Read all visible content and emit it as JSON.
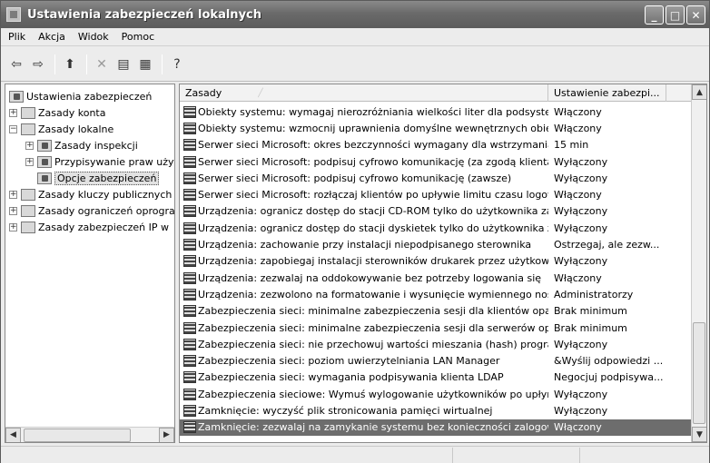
{
  "window": {
    "title": "Ustawienia zabezpieczeń lokalnych",
    "minimize": "_",
    "maximize": "□",
    "close": "✕"
  },
  "menu": [
    "Plik",
    "Akcja",
    "Widok",
    "Pomoc"
  ],
  "toolbar": {
    "icons": [
      "back-arrow-icon",
      "forward-arrow-icon",
      "up-folder-icon",
      "delete-icon",
      "properties-icon",
      "export-list-icon",
      "help-icon"
    ]
  },
  "tree": [
    {
      "label": "Ustawienia zabezpieczeń",
      "level": 0,
      "expander": "",
      "selected": false
    },
    {
      "label": "Zasady konta",
      "level": 1,
      "expander": "+",
      "selected": false
    },
    {
      "label": "Zasady lokalne",
      "level": 1,
      "expander": "−",
      "selected": false
    },
    {
      "label": "Zasady inspekcji",
      "level": 2,
      "expander": "+",
      "selected": false
    },
    {
      "label": "Przypisywanie praw użytkownika",
      "level": 2,
      "expander": "+",
      "selected": false
    },
    {
      "label": "Opcje zabezpieczeń",
      "level": 2,
      "expander": "",
      "selected": true
    },
    {
      "label": "Zasady kluczy publicznych",
      "level": 1,
      "expander": "+",
      "selected": false
    },
    {
      "label": "Zasady ograniczeń oprogramowania",
      "level": 1,
      "expander": "+",
      "selected": false
    },
    {
      "label": "Zasady zabezpieczeń IP w",
      "level": 1,
      "expander": "+",
      "selected": false
    }
  ],
  "list": {
    "headers": {
      "policy": "Zasady",
      "setting": "Ustawienie zabezpi..."
    },
    "rows": [
      {
        "policy": "Obiekty systemu: wymagaj nierozróżniania wielkości liter dla podsystemów...",
        "setting": "Włączony"
      },
      {
        "policy": "Obiekty systemu: wzmocnij uprawnienia domyślne wewnętrznych obiektó...",
        "setting": "Włączony"
      },
      {
        "policy": "Serwer sieci Microsoft: okres bezczynności wymagany dla wstrzymania sesji",
        "setting": "15 min"
      },
      {
        "policy": "Serwer sieci Microsoft: podpisuj cyfrowo komunikację (za zgodą klienta)",
        "setting": "Wyłączony"
      },
      {
        "policy": "Serwer sieci Microsoft: podpisuj cyfrowo komunikację (zawsze)",
        "setting": "Wyłączony"
      },
      {
        "policy": "Serwer sieci Microsoft: rozłączaj klientów po upływie limitu czasu logowania",
        "setting": "Włączony"
      },
      {
        "policy": "Urządzenia: ogranicz dostęp do stacji CD-ROM tylko do użytkownika zalog...",
        "setting": "Wyłączony"
      },
      {
        "policy": "Urządzenia: ogranicz dostęp do stacji dyskietek tylko do użytkownika zalo...",
        "setting": "Wyłączony"
      },
      {
        "policy": "Urządzenia: zachowanie przy instalacji niepodpisanego sterownika",
        "setting": "Ostrzegaj, ale zezw..."
      },
      {
        "policy": "Urządzenia: zapobiegaj instalacji sterowników drukarek przez użytkowników",
        "setting": "Wyłączony"
      },
      {
        "policy": "Urządzenia: zezwalaj na oddokowywanie bez potrzeby logowania się",
        "setting": "Włączony"
      },
      {
        "policy": "Urządzenia: zezwolono na formatowanie i wysunięcie wymiennego nośnika",
        "setting": "Administratorzy"
      },
      {
        "policy": "Zabezpieczenia sieci: minimalne zabezpieczenia sesji dla klientów opartych ...",
        "setting": "Brak minimum"
      },
      {
        "policy": "Zabezpieczenia sieci: minimalne zabezpieczenia sesji dla serwerów opartyc...",
        "setting": "Brak minimum"
      },
      {
        "policy": "Zabezpieczenia sieci: nie przechowuj wartości mieszania (hash) programu ...",
        "setting": "Wyłączony"
      },
      {
        "policy": "Zabezpieczenia sieci: poziom uwierzytelniania LAN Manager",
        "setting": "&Wyślij odpowiedzi ..."
      },
      {
        "policy": "Zabezpieczenia sieci: wymagania podpisywania klienta LDAP",
        "setting": "Negocjuj podpisywa..."
      },
      {
        "policy": "Zabezpieczenia sieciowe: Wymuś wylogowanie użytkowników po upłynięci...",
        "setting": "Wyłączony"
      },
      {
        "policy": "Zamknięcie: wyczyść plik stronicowania pamięci wirtualnej",
        "setting": "Wyłączony"
      },
      {
        "policy": "Zamknięcie: zezwalaj na zamykanie systemu bez konieczności zalogowania",
        "setting": "Włączony"
      }
    ],
    "selected_index": 19
  },
  "scroll": {
    "up": "▲",
    "down": "▼",
    "left": "◀",
    "right": "▶"
  }
}
